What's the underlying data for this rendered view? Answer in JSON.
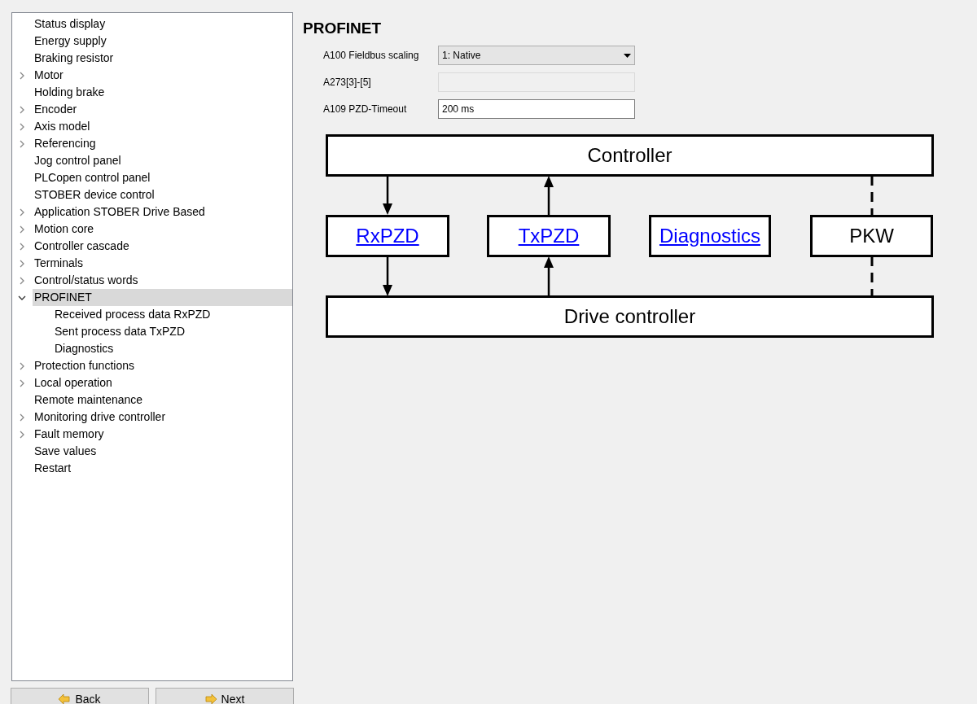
{
  "tree": [
    {
      "label": "Status display",
      "kind": "leaf",
      "selected": false
    },
    {
      "label": "Energy supply",
      "kind": "leaf",
      "selected": false
    },
    {
      "label": "Braking resistor",
      "kind": "leaf",
      "selected": false
    },
    {
      "label": "Motor",
      "kind": "branch",
      "expanded": false,
      "selected": false
    },
    {
      "label": "Holding brake",
      "kind": "leaf",
      "selected": false
    },
    {
      "label": "Encoder",
      "kind": "branch",
      "expanded": false,
      "selected": false
    },
    {
      "label": "Axis model",
      "kind": "branch",
      "expanded": false,
      "selected": false
    },
    {
      "label": "Referencing",
      "kind": "branch",
      "expanded": false,
      "selected": false
    },
    {
      "label": "Jog control panel",
      "kind": "leaf",
      "selected": false
    },
    {
      "label": "PLCopen control panel",
      "kind": "leaf",
      "selected": false
    },
    {
      "label": "STOBER device control",
      "kind": "leaf",
      "selected": false
    },
    {
      "label": "Application STOBER Drive Based",
      "kind": "branch",
      "expanded": false,
      "selected": false
    },
    {
      "label": "Motion core",
      "kind": "branch",
      "expanded": false,
      "selected": false
    },
    {
      "label": "Controller cascade",
      "kind": "branch",
      "expanded": false,
      "selected": false
    },
    {
      "label": "Terminals",
      "kind": "branch",
      "expanded": false,
      "selected": false
    },
    {
      "label": "Control/status words",
      "kind": "branch",
      "expanded": false,
      "selected": false
    },
    {
      "label": "PROFINET",
      "kind": "branch",
      "expanded": true,
      "selected": true,
      "children": [
        {
          "label": "Received process data RxPZD",
          "selected": false
        },
        {
          "label": "Sent process data TxPZD",
          "selected": false
        },
        {
          "label": "Diagnostics",
          "selected": false
        }
      ]
    },
    {
      "label": "Protection functions",
      "kind": "branch",
      "expanded": false,
      "selected": false
    },
    {
      "label": "Local operation",
      "kind": "branch",
      "expanded": false,
      "selected": false
    },
    {
      "label": "Remote maintenance",
      "kind": "leaf",
      "selected": false
    },
    {
      "label": "Monitoring drive controller",
      "kind": "branch",
      "expanded": false,
      "selected": false
    },
    {
      "label": "Fault memory",
      "kind": "branch",
      "expanded": false,
      "selected": false
    },
    {
      "label": "Save values",
      "kind": "leaf",
      "selected": false
    },
    {
      "label": "Restart",
      "kind": "leaf",
      "selected": false
    }
  ],
  "buttons": [
    {
      "label": "Back",
      "kind": "back"
    },
    {
      "label": "Next",
      "kind": "next"
    }
  ],
  "page": {
    "title": "PROFINET",
    "fields": [
      {
        "label": "A100 Fieldbus scaling",
        "kind": "dropdown",
        "value": "1: Native",
        "disabled": false
      },
      {
        "label": "A273[3]-[5]",
        "kind": "text",
        "disabled": true
      },
      {
        "label": "A109 PZD-Timeout",
        "kind": "text",
        "value": "200 ms",
        "disabled": false
      }
    ],
    "diagram": {
      "top": "Controller",
      "bottom": "Drive controller",
      "blocks": [
        {
          "label": "RxPZD",
          "kind": "link"
        },
        {
          "label": "TxPZD",
          "kind": "link"
        },
        {
          "label": "Diagnostics",
          "kind": "link"
        },
        {
          "label": "PKW",
          "kind": "plain"
        }
      ],
      "connectors": [
        {
          "kind": "down"
        },
        {
          "kind": "up"
        },
        {
          "kind": "none"
        },
        {
          "kind": "dashed"
        }
      ]
    }
  }
}
